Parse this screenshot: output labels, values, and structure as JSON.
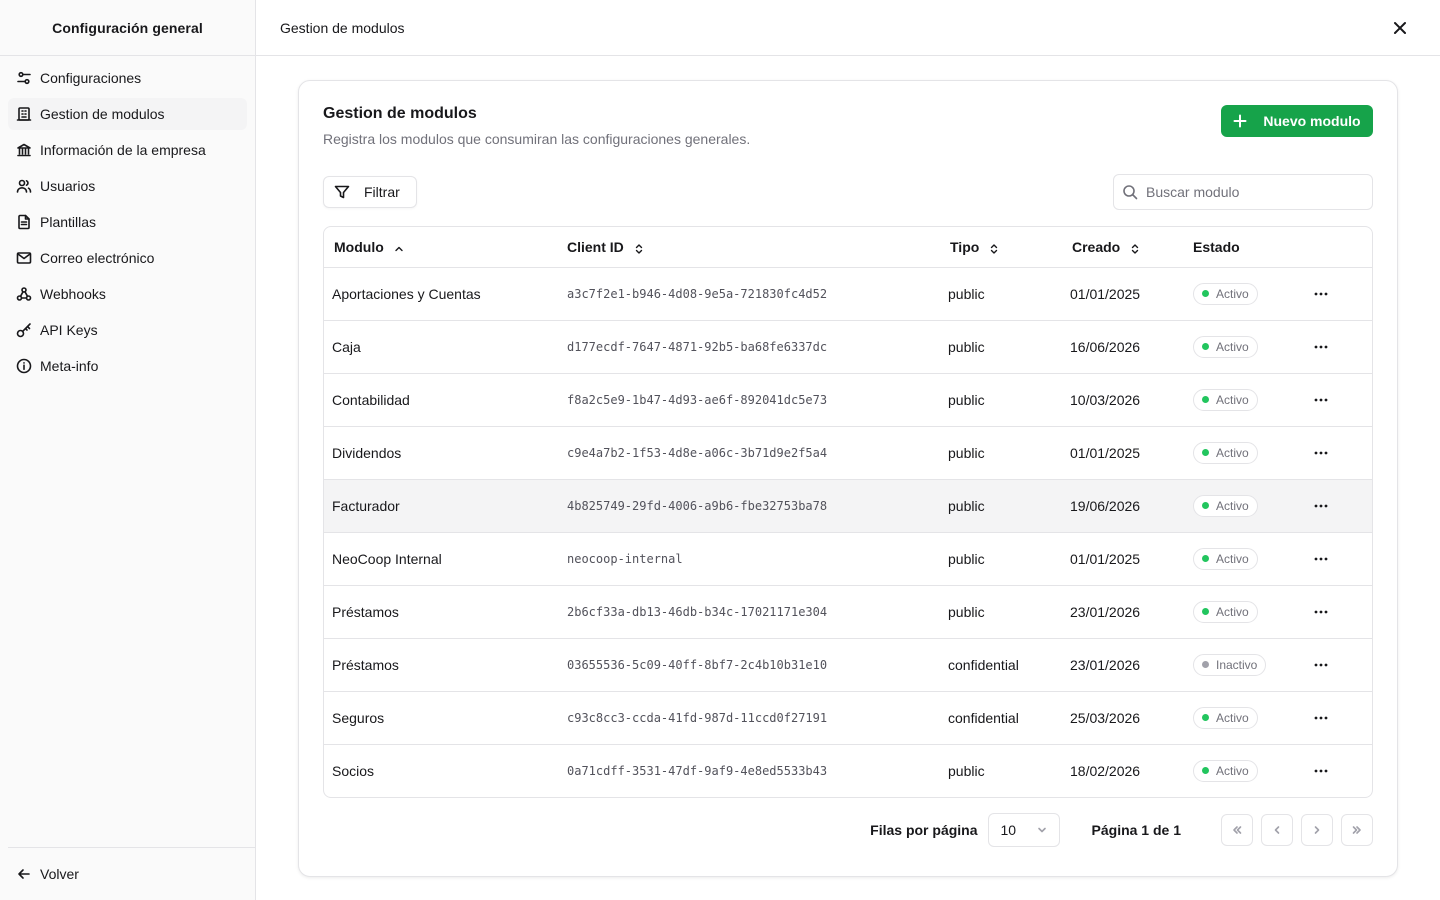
{
  "sidebar": {
    "title": "Configuración general",
    "items": [
      {
        "label": "Configuraciones",
        "icon": "settings-sliders-icon"
      },
      {
        "label": "Gestion de modulos",
        "icon": "building-icon"
      },
      {
        "label": "Información de la empresa",
        "icon": "bank-icon"
      },
      {
        "label": "Usuarios",
        "icon": "users-icon"
      },
      {
        "label": "Plantillas",
        "icon": "file-text-icon"
      },
      {
        "label": "Correo electrónico",
        "icon": "mail-icon"
      },
      {
        "label": "Webhooks",
        "icon": "webhook-icon"
      },
      {
        "label": "API Keys",
        "icon": "key-icon"
      },
      {
        "label": "Meta-info",
        "icon": "info-icon"
      }
    ],
    "active_index": 1,
    "back_label": "Volver"
  },
  "header": {
    "title": "Gestion de modulos"
  },
  "card": {
    "title": "Gestion de modulos",
    "subtitle": "Registra los modulos que consumiran las configuraciones generales.",
    "new_button": "Nuevo modulo",
    "filter_button": "Filtrar",
    "search_placeholder": "Buscar modulo"
  },
  "table": {
    "columns": {
      "modulo": "Modulo",
      "client_id": "Client ID",
      "tipo": "Tipo",
      "creado": "Creado",
      "estado": "Estado"
    },
    "rows": [
      {
        "modulo": "Aportaciones y Cuentas",
        "client_id": "a3c7f2e1-b946-4d08-9e5a-721830fc4d52",
        "tipo": "public",
        "creado": "01/01/2025",
        "estado": "Activo",
        "active": true
      },
      {
        "modulo": "Caja",
        "client_id": "d177ecdf-7647-4871-92b5-ba68fe6337dc",
        "tipo": "public",
        "creado": "16/06/2026",
        "estado": "Activo",
        "active": true
      },
      {
        "modulo": "Contabilidad",
        "client_id": "f8a2c5e9-1b47-4d93-ae6f-892041dc5e73",
        "tipo": "public",
        "creado": "10/03/2026",
        "estado": "Activo",
        "active": true
      },
      {
        "modulo": "Dividendos",
        "client_id": "c9e4a7b2-1f53-4d8e-a06c-3b71d9e2f5a4",
        "tipo": "public",
        "creado": "01/01/2025",
        "estado": "Activo",
        "active": true
      },
      {
        "modulo": "Facturador",
        "client_id": "4b825749-29fd-4006-a9b6-fbe32753ba78",
        "tipo": "public",
        "creado": "19/06/2026",
        "estado": "Activo",
        "active": true
      },
      {
        "modulo": "NeoCoop Internal",
        "client_id": "neocoop-internal",
        "tipo": "public",
        "creado": "01/01/2025",
        "estado": "Activo",
        "active": true
      },
      {
        "modulo": "Préstamos",
        "client_id": "2b6cf33a-db13-46db-b34c-17021171e304",
        "tipo": "public",
        "creado": "23/01/2026",
        "estado": "Activo",
        "active": true
      },
      {
        "modulo": "Préstamos",
        "client_id": "03655536-5c09-40ff-8bf7-2c4b10b31e10",
        "tipo": "confidential",
        "creado": "23/01/2026",
        "estado": "Inactivo",
        "active": false
      },
      {
        "modulo": "Seguros",
        "client_id": "c93c8cc3-ccda-41fd-987d-11ccd0f27191",
        "tipo": "confidential",
        "creado": "25/03/2026",
        "estado": "Activo",
        "active": true
      },
      {
        "modulo": "Socios",
        "client_id": "0a71cdff-3531-47df-9af9-4e8ed5533b43",
        "tipo": "public",
        "creado": "18/02/2026",
        "estado": "Activo",
        "active": true
      }
    ],
    "hovered_row_index": 4
  },
  "pagination": {
    "rows_label": "Filas por página",
    "rows_value": "10",
    "page_label": "Página 1 de 1"
  },
  "colors": {
    "accent": "#16a34a",
    "active_dot": "#22c55e",
    "inactive_dot": "#a1a1aa",
    "border": "#e4e4e7"
  }
}
